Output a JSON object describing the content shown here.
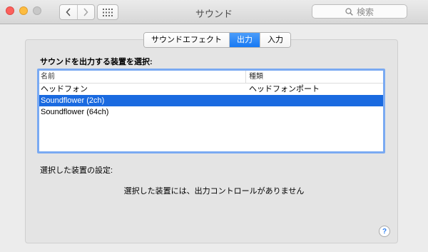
{
  "window": {
    "title": "サウンド",
    "search": {
      "placeholder": "検索",
      "icon": "search-icon"
    }
  },
  "toolbar": {
    "back_icon": "chevron-left-icon",
    "forward_icon": "chevron-right-icon",
    "grid_icon": "grid-icon"
  },
  "tabs": [
    {
      "label": "サウンドエフェクト",
      "active": false
    },
    {
      "label": "出力",
      "active": true
    },
    {
      "label": "入力",
      "active": false
    }
  ],
  "output": {
    "heading": "サウンドを出力する装置を選択:",
    "columns": [
      "名前",
      "種類"
    ],
    "devices": [
      {
        "name": "ヘッドフォン",
        "type": "ヘッドフォンポート",
        "selected": false
      },
      {
        "name": "Soundflower (2ch)",
        "type": "",
        "selected": true
      },
      {
        "name": "Soundflower (64ch)",
        "type": "",
        "selected": false
      }
    ],
    "settings_label": "選択した装置の設定:",
    "no_controls_message": "選択した装置には、出力コントロールがありません"
  },
  "help": {
    "label": "?"
  },
  "colors": {
    "accent": "#1a6ae0",
    "selected_tab": "#1779f3",
    "close": "#fc605c",
    "minimize": "#fdbc40"
  }
}
